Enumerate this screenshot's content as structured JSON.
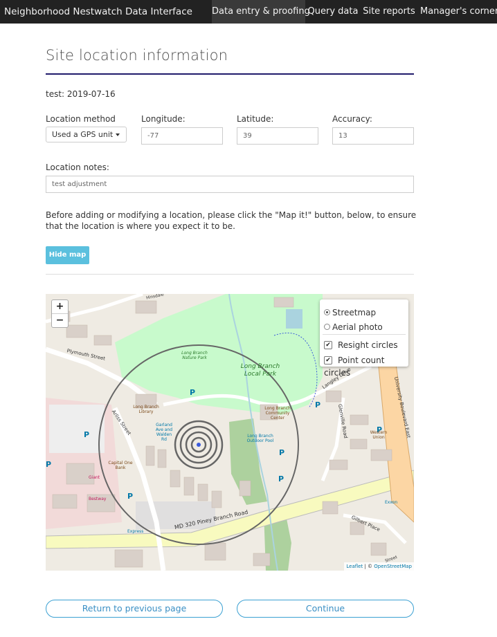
{
  "navbar": {
    "brand": "Neighborhood Nestwatch Data Interface",
    "items": [
      {
        "label": "Data entry & proofing",
        "active": true
      },
      {
        "label": "Query data",
        "active": false
      },
      {
        "label": "Site reports",
        "active": false
      },
      {
        "label": "Manager's corner",
        "active": false
      }
    ]
  },
  "page": {
    "title": "Site location information",
    "subtitle": "test: 2019-07-16"
  },
  "form": {
    "method_label": "Location method",
    "method_value": "Used a GPS unit",
    "longitude_label": "Longitude:",
    "longitude_value": "-77",
    "latitude_label": "Latitude:",
    "latitude_value": "39",
    "accuracy_label": "Accuracy:",
    "accuracy_value": "13",
    "notes_label": "Location notes:",
    "notes_value": "test adjustment",
    "instructions": "Before adding or modifying a location, please click the \"Map it!\" button, below, to ensure that the location is where you expect it to be.",
    "hide_map_label": "Hide map"
  },
  "map": {
    "zoom_in": "+",
    "zoom_out": "−",
    "layers": {
      "streetmap": "Streetmap",
      "aerial": "Aerial photo",
      "resight": "Resight circles",
      "pointcount": "Point count circles"
    },
    "labels": {
      "park": "Long Branch Local Park",
      "park2": "Long Branch Nature Park",
      "plymouth": "Plymouth Street",
      "arliss": "Arliss Street",
      "library": "Long Branch Library",
      "garland": "Garland Ave and Walden Rd",
      "community": "Long Branch Community Center",
      "outdoor": "Long Branch Outdoor Pool",
      "langley": "Langley Drive",
      "glenville": "Glenville Road",
      "university": "University Boulevard East",
      "piney": "MD 320 Piney Branch Road",
      "gilbert": "Gilbert Place",
      "capital": "Capital One Bank",
      "giant": "Giant",
      "westernunion": "Western Union",
      "exxon": "Exxon",
      "express": "Express",
      "bestway": "Bestway",
      "street": "Street",
      "hinsdale": "Hinsdale"
    },
    "attribution_leaflet": "Leaflet",
    "attribution_sep": " | © ",
    "attribution_osm": "OpenStreetMap"
  },
  "footer": {
    "back_label": "Return to previous page",
    "continue_label": "Continue"
  },
  "colors": {
    "navbar": "#222222",
    "accent": "#5bc0de",
    "title_rule": "#1f1a6b",
    "outline_button": "#3aa0d2"
  }
}
